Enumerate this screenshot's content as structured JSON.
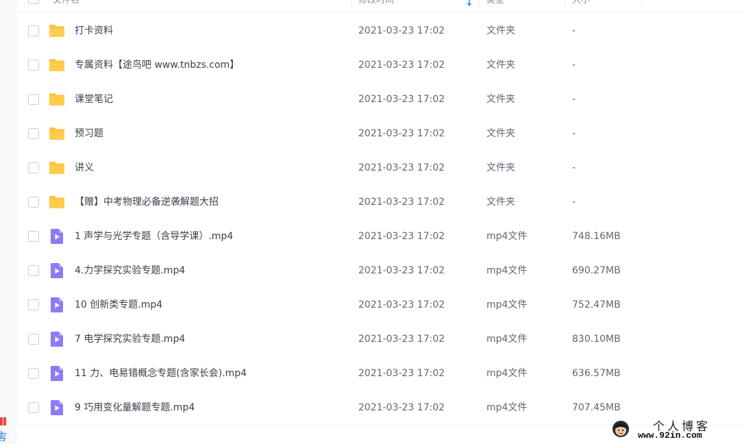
{
  "header": {
    "name_label": "文件名",
    "time_label": "修改时间",
    "type_label": "类型",
    "size_label": "大小"
  },
  "files": [
    {
      "name": "打卡资料",
      "time": "2021-03-23 17:02",
      "type": "文件夹",
      "size": "-",
      "icon": "folder-icon"
    },
    {
      "name": "专属资料【途鸟吧 www.tnbzs.com】",
      "time": "2021-03-23 17:02",
      "type": "文件夹",
      "size": "-",
      "icon": "folder-icon"
    },
    {
      "name": "课堂笔记",
      "time": "2021-03-23 17:02",
      "type": "文件夹",
      "size": "-",
      "icon": "folder-icon"
    },
    {
      "name": "预习题",
      "time": "2021-03-23 17:02",
      "type": "文件夹",
      "size": "-",
      "icon": "folder-icon"
    },
    {
      "name": "讲义",
      "time": "2021-03-23 17:02",
      "type": "文件夹",
      "size": "-",
      "icon": "folder-icon"
    },
    {
      "name": "【赠】中考物理必备逆袭解题大招",
      "time": "2021-03-23 17:02",
      "type": "文件夹",
      "size": "-",
      "icon": "folder-icon"
    },
    {
      "name": "1 声学与光学专题（含导学课）.mp4",
      "time": "2021-03-23 17:02",
      "type": "mp4文件",
      "size": "748.16MB",
      "icon": "video-file-icon"
    },
    {
      "name": "4.力学探究实验专题.mp4",
      "time": "2021-03-23 17:02",
      "type": "mp4文件",
      "size": "690.27MB",
      "icon": "video-file-icon"
    },
    {
      "name": "10 创新类专题.mp4",
      "time": "2021-03-23 17:02",
      "type": "mp4文件",
      "size": "752.47MB",
      "icon": "video-file-icon"
    },
    {
      "name": "7 电学探究实验专题.mp4",
      "time": "2021-03-23 17:02",
      "type": "mp4文件",
      "size": "830.10MB",
      "icon": "video-file-icon"
    },
    {
      "name": "11 力、电易错概念专题(含家长会).mp4",
      "time": "2021-03-23 17:02",
      "type": "mp4文件",
      "size": "636.57MB",
      "icon": "video-file-icon"
    },
    {
      "name": "9 巧用变化量解题专题.mp4",
      "time": "2021-03-23 17:02",
      "type": "mp4文件",
      "size": "707.45MB",
      "icon": "video-file-icon"
    }
  ],
  "sidebar": {
    "cut_text": "容"
  },
  "watermark": {
    "title": "个人博客",
    "url": "www.92in.com"
  },
  "colors": {
    "folder": "#ffc43d",
    "video": "#8b7cf6",
    "accent": "#2a8cf5"
  }
}
